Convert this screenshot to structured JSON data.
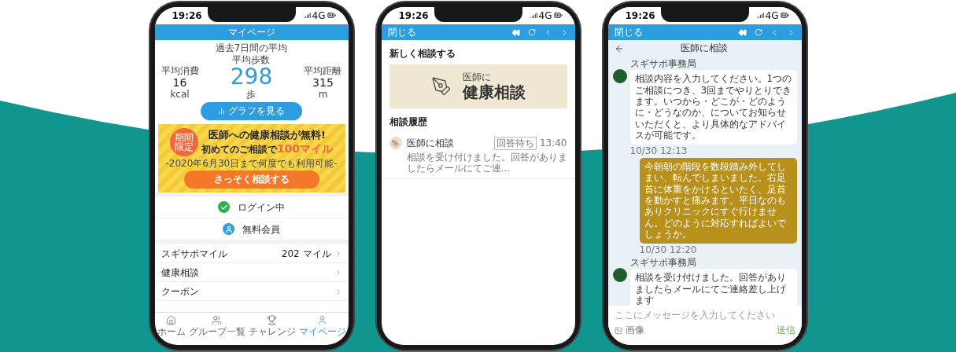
{
  "phones": [
    {
      "kind": "mypage",
      "status_time": "19:26",
      "status_network": "4G",
      "header_title": "マイページ",
      "stats": {
        "period": "過去7日間の平均",
        "items": [
          {
            "kind": "side",
            "label": "平均消費",
            "value": "16",
            "unit": "kcal"
          },
          {
            "kind": "main",
            "label": "平均歩数",
            "value": "298",
            "unit": "歩"
          },
          {
            "kind": "side",
            "label": "平均距離",
            "value": "315",
            "unit": "m"
          }
        ]
      },
      "graph_button": "グラフを見る",
      "banner": {
        "badge": "期間限定",
        "headline": "医師への健康相談が無料!",
        "subline": "初めてのご相談で",
        "highlight": "100マイル",
        "note": "-2020年6月30日まで何度でも利用可能-",
        "button": "さっそく相談する"
      },
      "status_rows": [
        {
          "kind": "login",
          "label": "ログイン中"
        },
        {
          "kind": "member",
          "label": "無料会員"
        }
      ],
      "menu": [
        {
          "label": "スギサポマイル",
          "value": "202 マイル"
        },
        {
          "label": "健康相談"
        },
        {
          "label": "クーポン"
        }
      ],
      "tabs": [
        {
          "kind": "home",
          "label": "ホーム",
          "selected": false
        },
        {
          "kind": "group",
          "label": "グループ一覧",
          "selected": false
        },
        {
          "kind": "challenge",
          "label": "チャレンジ",
          "selected": false
        },
        {
          "kind": "mypage",
          "label": "マイページ",
          "selected": true
        }
      ]
    },
    {
      "kind": "consult-list",
      "status_time": "19:26",
      "status_network": "4G",
      "close_label": "閉じる",
      "new_title": "新しく相談する",
      "card": {
        "small": "医師に",
        "big": "健康相談"
      },
      "history_title": "相談履歴",
      "history": [
        {
          "title": "医師に相談",
          "badge": "回答待ち",
          "time": "13:40",
          "preview": "相談を受け付けました。回答がありましたらメールにてご連..."
        }
      ]
    },
    {
      "kind": "chat",
      "status_time": "19:26",
      "status_network": "4G",
      "close_label": "閉じる",
      "title": "医師に相談",
      "messages": [
        {
          "kind": "received",
          "sender": "スギサポ事務局",
          "text": "相談内容を入力してください。1つのご相談につき、3回までやりとりできます。いつから・どこが・どのように・どうなのか、についてお知らせいただくと、より具体的なアドバイスが可能です。",
          "time": "10/30 12:13"
        },
        {
          "kind": "sent",
          "text": "今朝朝の階段を数段踏み外してしまい、転んでしまいました。右足首に体重をかけるといたく、足首を動かすと痛みます。平日なのもありクリニックにすぐ行けません。どのように対応すればよいでしょうか。",
          "time": "10/30 12:20"
        },
        {
          "kind": "received",
          "sender": "スギサポ事務局",
          "text": "相談を受け付けました。回答がありましたらメールにてご連絡差し上げます"
        }
      ],
      "input_placeholder": "ここにメッセージを入力してください",
      "attach_label": "画像",
      "send_label": "送信"
    }
  ]
}
